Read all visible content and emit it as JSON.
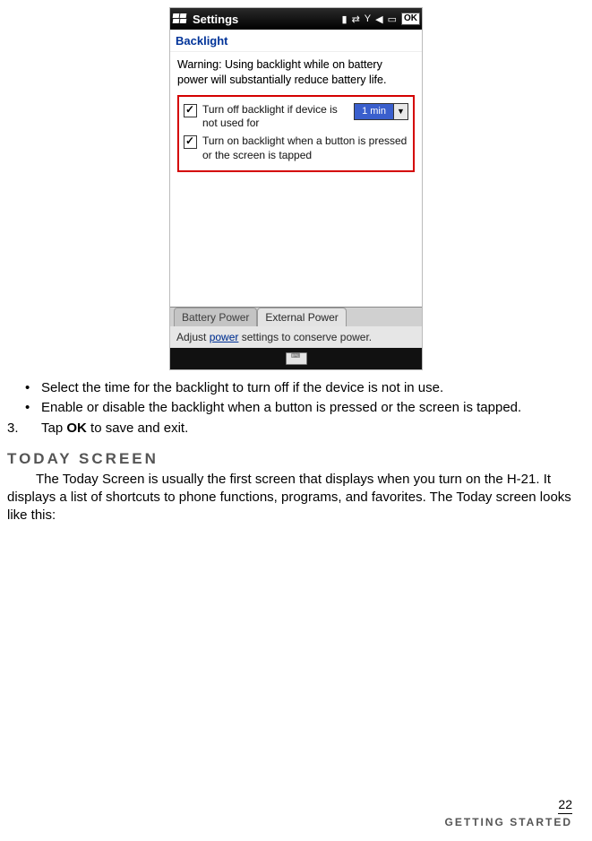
{
  "shot": {
    "title": "Settings",
    "ok": "OK",
    "section": "Backlight",
    "warning": "Warning: Using backlight while on battery power will substantially reduce battery life.",
    "opt1": "Turn off backlight if device is not used for",
    "opt1_value": "1 min",
    "opt2": "Turn on backlight when a button is pressed or the screen is tapped",
    "tab1": "Battery Power",
    "tab2": "External Power",
    "adjust_pre": "Adjust ",
    "adjust_link": "power",
    "adjust_post": " settings to conserve power."
  },
  "doc": {
    "bullet1": "Select the time for the backlight to turn off if the device is not in use.",
    "bullet2": "Enable or disable the backlight when a button is pressed or the screen is tapped.",
    "step3_num": "3.",
    "step3_pre": "Tap ",
    "step3_bold": "OK",
    "step3_post": " to save and exit.",
    "section_head": "Today Screen",
    "para1": "The Today Screen is usually the first screen that displays when you turn on the H-21. It displays a list of shortcuts to phone functions, programs, and favorites. The Today screen looks like this:"
  },
  "footer": {
    "page": "22",
    "chapter": "Getting Started"
  }
}
